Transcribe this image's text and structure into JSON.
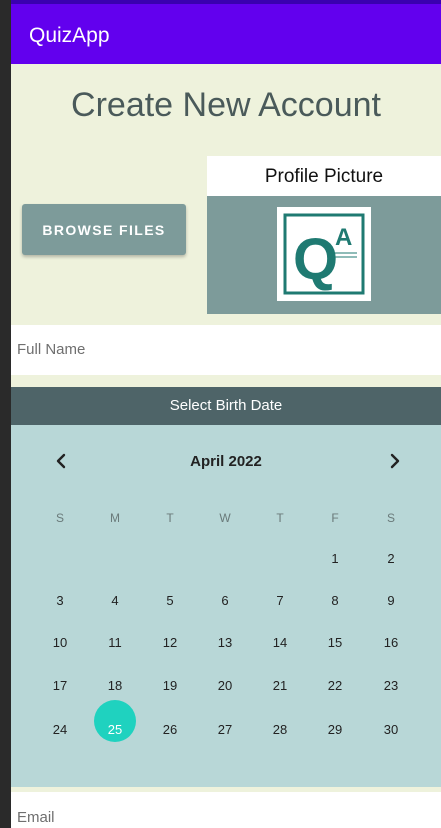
{
  "appbar": {
    "title": "QuizApp"
  },
  "page": {
    "heading": "Create New Account"
  },
  "browse": {
    "label": "BROWSE FILES"
  },
  "profile": {
    "label": "Profile Picture",
    "logo_text": [
      "Q",
      "A"
    ]
  },
  "fields": {
    "full_name": "Full Name",
    "email": "Email"
  },
  "calendar": {
    "header": "Select Birth Date",
    "month": "April 2022",
    "weekdays": [
      "S",
      "M",
      "T",
      "W",
      "T",
      "F",
      "S"
    ],
    "rows": [
      [
        "",
        "",
        "",
        "",
        "",
        "1",
        "2"
      ],
      [
        "3",
        "4",
        "5",
        "6",
        "7",
        "8",
        "9"
      ],
      [
        "10",
        "11",
        "12",
        "13",
        "14",
        "15",
        "16"
      ],
      [
        "17",
        "18",
        "19",
        "20",
        "21",
        "22",
        "23"
      ],
      [
        "24",
        "25",
        "26",
        "27",
        "28",
        "29",
        "30"
      ]
    ],
    "selected": "25"
  },
  "colors": {
    "appbar": "#6200ee",
    "background": "#eef2dc",
    "button": "#7d9b9a",
    "calendar_header": "#4e6468",
    "calendar_body": "#b8d7d7",
    "selected": "#1fd2bf",
    "logo": "#1f7a72"
  }
}
